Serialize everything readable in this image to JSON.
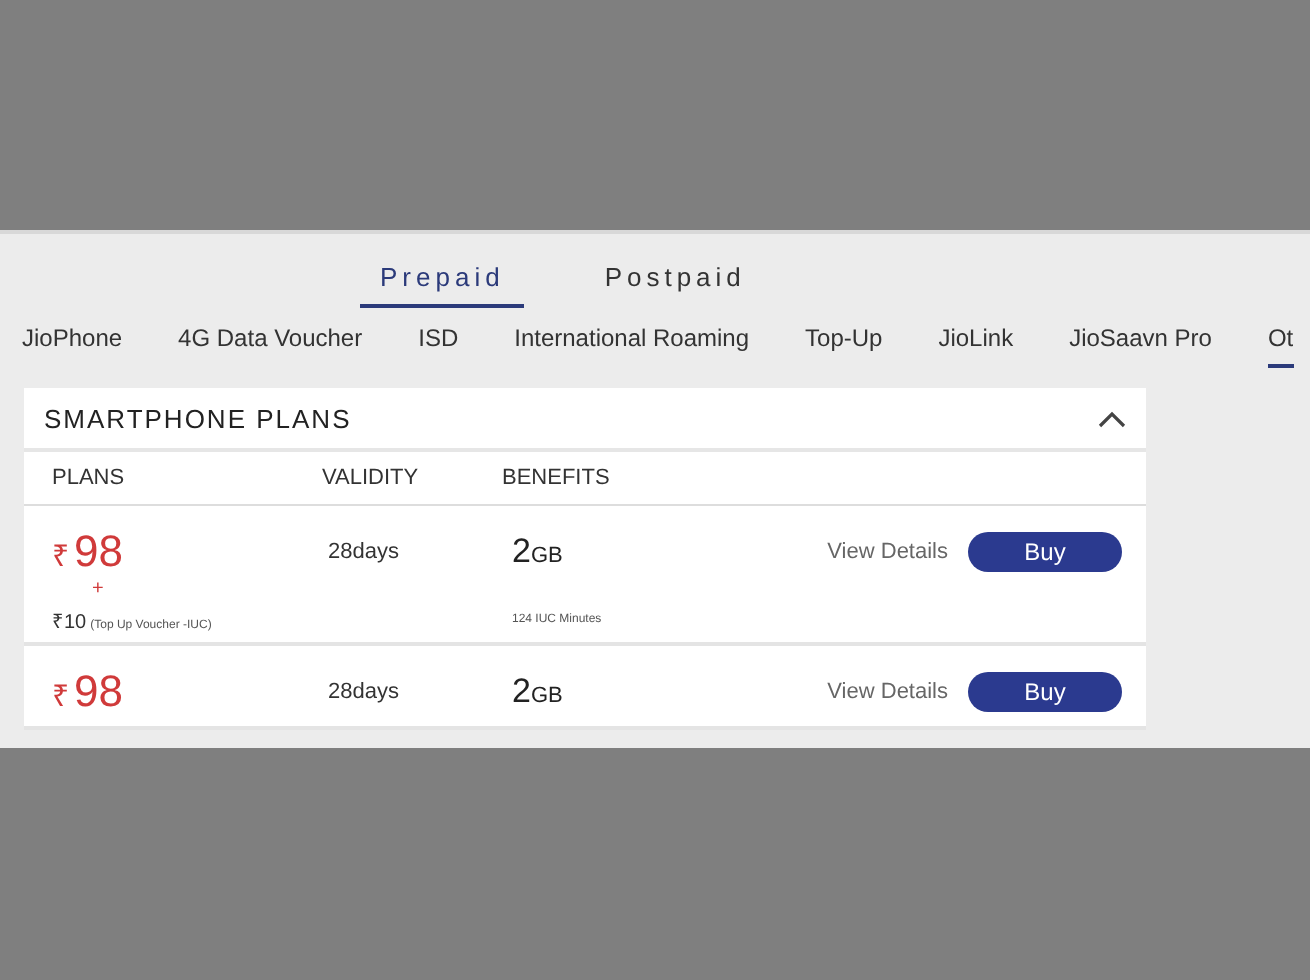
{
  "plan_types": [
    {
      "label": "Prepaid",
      "selected": true
    },
    {
      "label": "Postpaid",
      "selected": false
    }
  ],
  "categories": [
    {
      "label": "JioPhone",
      "selected": false
    },
    {
      "label": "4G Data Voucher",
      "selected": false
    },
    {
      "label": "ISD",
      "selected": false
    },
    {
      "label": "International Roaming",
      "selected": false
    },
    {
      "label": "Top-Up",
      "selected": false
    },
    {
      "label": "JioLink",
      "selected": false
    },
    {
      "label": "JioSaavn Pro",
      "selected": false
    },
    {
      "label": "Ot",
      "selected": true
    }
  ],
  "section": {
    "title": "SMARTPHONE PLANS",
    "expanded": true,
    "columns": [
      "PLANS",
      "VALIDITY",
      "BENEFITS"
    ],
    "rows": [
      {
        "currency": "₹",
        "price": "98",
        "plus": "+",
        "addon_amount": "₹10",
        "addon_note": "(Top Up Voucher -IUC)",
        "validity": "28days",
        "data": "2",
        "data_unit": "GB",
        "benefit_note": "124 IUC Minutes",
        "details": "View Details",
        "buy": "Buy"
      },
      {
        "currency": "₹",
        "price": "98",
        "validity": "28days",
        "data": "2",
        "data_unit": "GB",
        "details": "View Details",
        "buy": "Buy"
      }
    ]
  }
}
